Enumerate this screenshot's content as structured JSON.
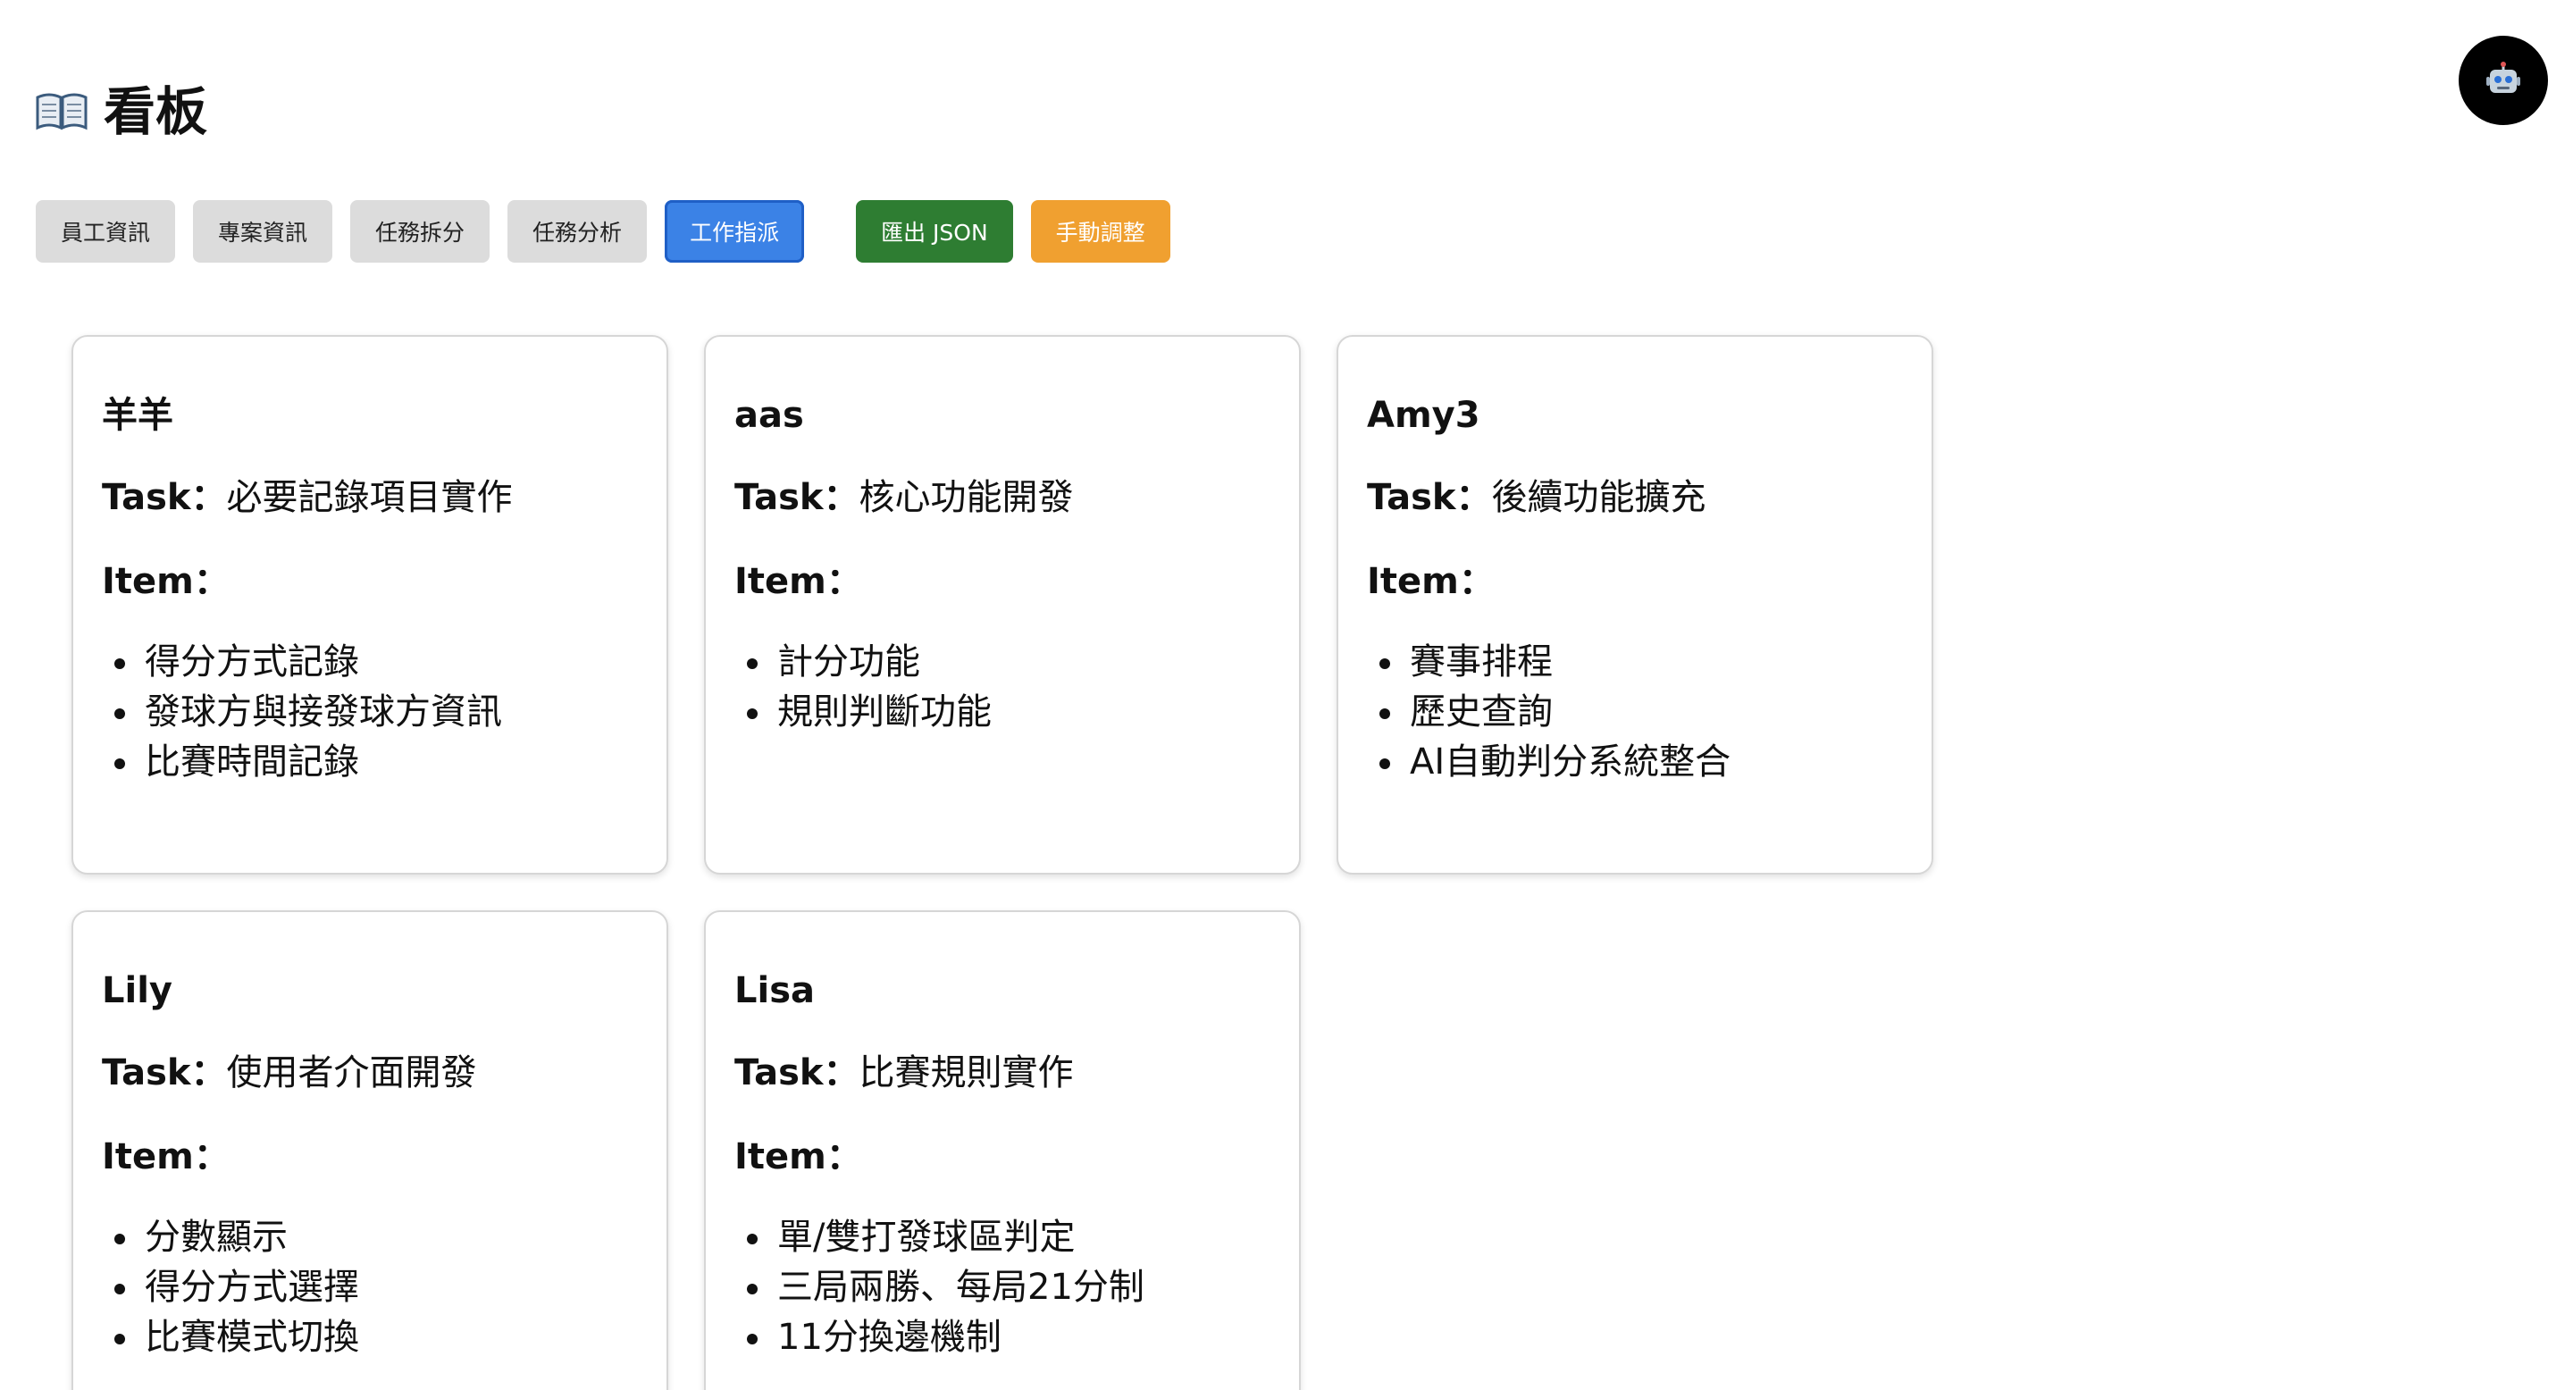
{
  "header": {
    "icon": "open-book-icon",
    "title": "看板"
  },
  "bot_button": {
    "icon": "robot-icon",
    "bg_color": "#000000"
  },
  "toolbar": {
    "tabs": [
      {
        "label": "員工資訊",
        "active": false
      },
      {
        "label": "專案資訊",
        "active": false
      },
      {
        "label": "任務拆分",
        "active": false
      },
      {
        "label": "任務分析",
        "active": false
      },
      {
        "label": "工作指派",
        "active": true
      }
    ],
    "export_label": "匯出 JSON",
    "manual_label": "手動調整"
  },
  "labels": {
    "task": "Task：",
    "item": "Item："
  },
  "colors": {
    "active_tab": "#3b82e6",
    "export": "#2e7d32",
    "manual": "#f0a030",
    "tab": "#dcdcdc"
  },
  "cards": [
    {
      "name": "羊羊",
      "task": "必要記錄項目實作",
      "items": [
        "得分方式記錄",
        "發球方與接發球方資訊",
        "比賽時間記錄"
      ]
    },
    {
      "name": "aas",
      "task": "核心功能開發",
      "items": [
        "計分功能",
        "規則判斷功能"
      ]
    },
    {
      "name": "Amy3",
      "task": "後續功能擴充",
      "items": [
        "賽事排程",
        "歷史查詢",
        "AI自動判分系統整合"
      ]
    },
    {
      "name": "Lily",
      "task": "使用者介面開發",
      "items": [
        "分數顯示",
        "得分方式選擇",
        "比賽模式切換"
      ]
    },
    {
      "name": "Lisa",
      "task": "比賽規則實作",
      "items": [
        "單/雙打發球區判定",
        "三局兩勝、每局21分制",
        "11分換邊機制"
      ]
    }
  ]
}
